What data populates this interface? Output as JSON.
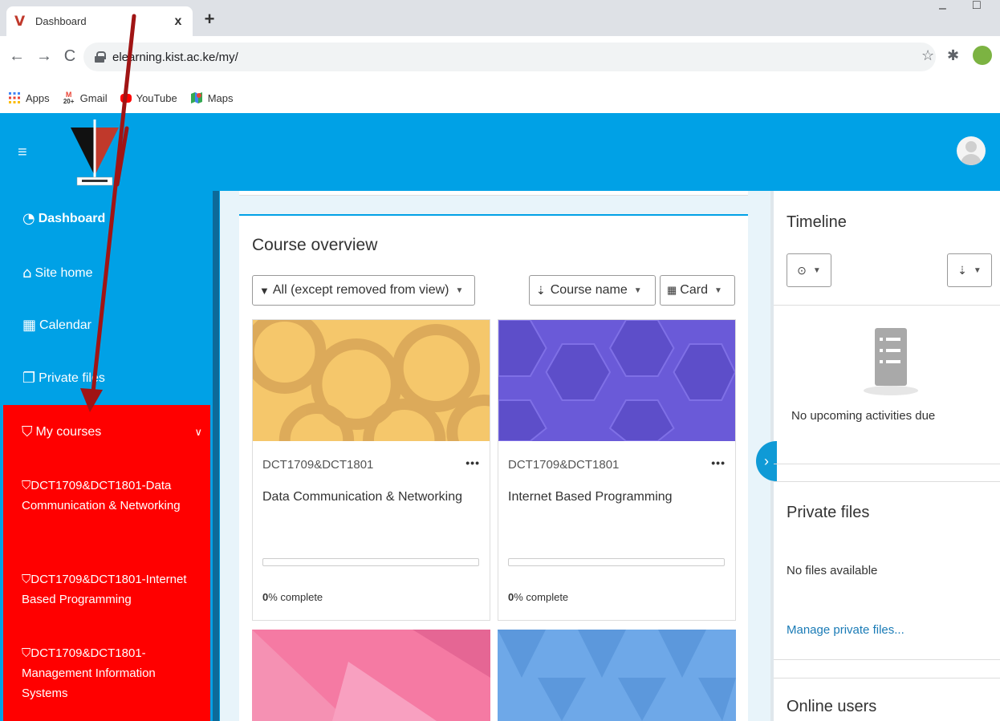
{
  "browser": {
    "tab_title": "Dashboard",
    "tab_close": "x",
    "new_tab": "+",
    "url": "elearning.kist.ac.ke/my/",
    "bookmarks": [
      "Apps",
      "Gmail",
      "YouTube",
      "Maps"
    ],
    "gmail_badge": "20+"
  },
  "sidebar": {
    "items": [
      {
        "label": "Dashboard",
        "icon": "dashboard-icon"
      },
      {
        "label": "Site home",
        "icon": "home-icon"
      },
      {
        "label": "Calendar",
        "icon": "calendar-icon"
      },
      {
        "label": "Private files",
        "icon": "file-icon"
      }
    ],
    "my_courses_label": "My courses",
    "courses": [
      "DCT1709&DCT1801-Data Communication & Networking",
      "DCT1709&DCT1801-Internet Based Programming",
      "DCT1709&DCT1801-Management Information Systems"
    ]
  },
  "main": {
    "title": "Course overview",
    "filter_label": "All (except removed from view)",
    "sort_label": "Course name",
    "view_label": "Card",
    "cards": [
      {
        "category": "DCT1709&DCT1801",
        "name": "Data Communication & Networking",
        "progress": 0,
        "progress_label": "0",
        "complete_text": "% complete"
      },
      {
        "category": "DCT1709&DCT1801",
        "name": "Internet Based Programming",
        "progress": 0,
        "progress_label": "0",
        "complete_text": "% complete"
      }
    ]
  },
  "right": {
    "timeline_title": "Timeline",
    "timeline_empty": "No upcoming activities due",
    "private_files_title": "Private files",
    "private_files_empty": "No files available",
    "manage_link": "Manage private files...",
    "online_users_title": "Online users"
  },
  "colors": {
    "brand_blue": "#00a1e6",
    "highlight_red": "#ff0000",
    "arrow": "#a01414"
  }
}
